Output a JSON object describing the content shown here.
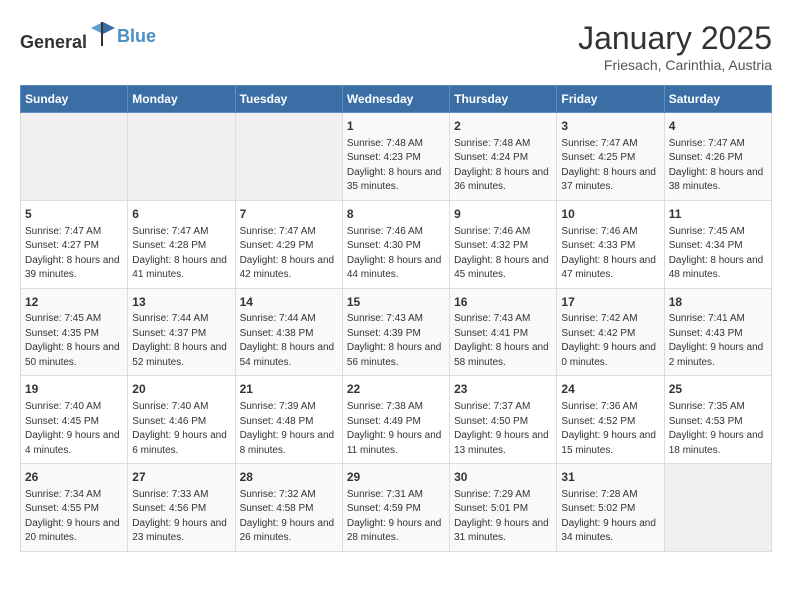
{
  "header": {
    "logo_general": "General",
    "logo_blue": "Blue",
    "month": "January 2025",
    "location": "Friesach, Carinthia, Austria"
  },
  "days_of_week": [
    "Sunday",
    "Monday",
    "Tuesday",
    "Wednesday",
    "Thursday",
    "Friday",
    "Saturday"
  ],
  "weeks": [
    [
      {
        "day": "",
        "content": ""
      },
      {
        "day": "",
        "content": ""
      },
      {
        "day": "",
        "content": ""
      },
      {
        "day": "1",
        "content": "Sunrise: 7:48 AM\nSunset: 4:23 PM\nDaylight: 8 hours and 35 minutes."
      },
      {
        "day": "2",
        "content": "Sunrise: 7:48 AM\nSunset: 4:24 PM\nDaylight: 8 hours and 36 minutes."
      },
      {
        "day": "3",
        "content": "Sunrise: 7:47 AM\nSunset: 4:25 PM\nDaylight: 8 hours and 37 minutes."
      },
      {
        "day": "4",
        "content": "Sunrise: 7:47 AM\nSunset: 4:26 PM\nDaylight: 8 hours and 38 minutes."
      }
    ],
    [
      {
        "day": "5",
        "content": "Sunrise: 7:47 AM\nSunset: 4:27 PM\nDaylight: 8 hours and 39 minutes."
      },
      {
        "day": "6",
        "content": "Sunrise: 7:47 AM\nSunset: 4:28 PM\nDaylight: 8 hours and 41 minutes."
      },
      {
        "day": "7",
        "content": "Sunrise: 7:47 AM\nSunset: 4:29 PM\nDaylight: 8 hours and 42 minutes."
      },
      {
        "day": "8",
        "content": "Sunrise: 7:46 AM\nSunset: 4:30 PM\nDaylight: 8 hours and 44 minutes."
      },
      {
        "day": "9",
        "content": "Sunrise: 7:46 AM\nSunset: 4:32 PM\nDaylight: 8 hours and 45 minutes."
      },
      {
        "day": "10",
        "content": "Sunrise: 7:46 AM\nSunset: 4:33 PM\nDaylight: 8 hours and 47 minutes."
      },
      {
        "day": "11",
        "content": "Sunrise: 7:45 AM\nSunset: 4:34 PM\nDaylight: 8 hours and 48 minutes."
      }
    ],
    [
      {
        "day": "12",
        "content": "Sunrise: 7:45 AM\nSunset: 4:35 PM\nDaylight: 8 hours and 50 minutes."
      },
      {
        "day": "13",
        "content": "Sunrise: 7:44 AM\nSunset: 4:37 PM\nDaylight: 8 hours and 52 minutes."
      },
      {
        "day": "14",
        "content": "Sunrise: 7:44 AM\nSunset: 4:38 PM\nDaylight: 8 hours and 54 minutes."
      },
      {
        "day": "15",
        "content": "Sunrise: 7:43 AM\nSunset: 4:39 PM\nDaylight: 8 hours and 56 minutes."
      },
      {
        "day": "16",
        "content": "Sunrise: 7:43 AM\nSunset: 4:41 PM\nDaylight: 8 hours and 58 minutes."
      },
      {
        "day": "17",
        "content": "Sunrise: 7:42 AM\nSunset: 4:42 PM\nDaylight: 9 hours and 0 minutes."
      },
      {
        "day": "18",
        "content": "Sunrise: 7:41 AM\nSunset: 4:43 PM\nDaylight: 9 hours and 2 minutes."
      }
    ],
    [
      {
        "day": "19",
        "content": "Sunrise: 7:40 AM\nSunset: 4:45 PM\nDaylight: 9 hours and 4 minutes."
      },
      {
        "day": "20",
        "content": "Sunrise: 7:40 AM\nSunset: 4:46 PM\nDaylight: 9 hours and 6 minutes."
      },
      {
        "day": "21",
        "content": "Sunrise: 7:39 AM\nSunset: 4:48 PM\nDaylight: 9 hours and 8 minutes."
      },
      {
        "day": "22",
        "content": "Sunrise: 7:38 AM\nSunset: 4:49 PM\nDaylight: 9 hours and 11 minutes."
      },
      {
        "day": "23",
        "content": "Sunrise: 7:37 AM\nSunset: 4:50 PM\nDaylight: 9 hours and 13 minutes."
      },
      {
        "day": "24",
        "content": "Sunrise: 7:36 AM\nSunset: 4:52 PM\nDaylight: 9 hours and 15 minutes."
      },
      {
        "day": "25",
        "content": "Sunrise: 7:35 AM\nSunset: 4:53 PM\nDaylight: 9 hours and 18 minutes."
      }
    ],
    [
      {
        "day": "26",
        "content": "Sunrise: 7:34 AM\nSunset: 4:55 PM\nDaylight: 9 hours and 20 minutes."
      },
      {
        "day": "27",
        "content": "Sunrise: 7:33 AM\nSunset: 4:56 PM\nDaylight: 9 hours and 23 minutes."
      },
      {
        "day": "28",
        "content": "Sunrise: 7:32 AM\nSunset: 4:58 PM\nDaylight: 9 hours and 26 minutes."
      },
      {
        "day": "29",
        "content": "Sunrise: 7:31 AM\nSunset: 4:59 PM\nDaylight: 9 hours and 28 minutes."
      },
      {
        "day": "30",
        "content": "Sunrise: 7:29 AM\nSunset: 5:01 PM\nDaylight: 9 hours and 31 minutes."
      },
      {
        "day": "31",
        "content": "Sunrise: 7:28 AM\nSunset: 5:02 PM\nDaylight: 9 hours and 34 minutes."
      },
      {
        "day": "",
        "content": ""
      }
    ]
  ]
}
